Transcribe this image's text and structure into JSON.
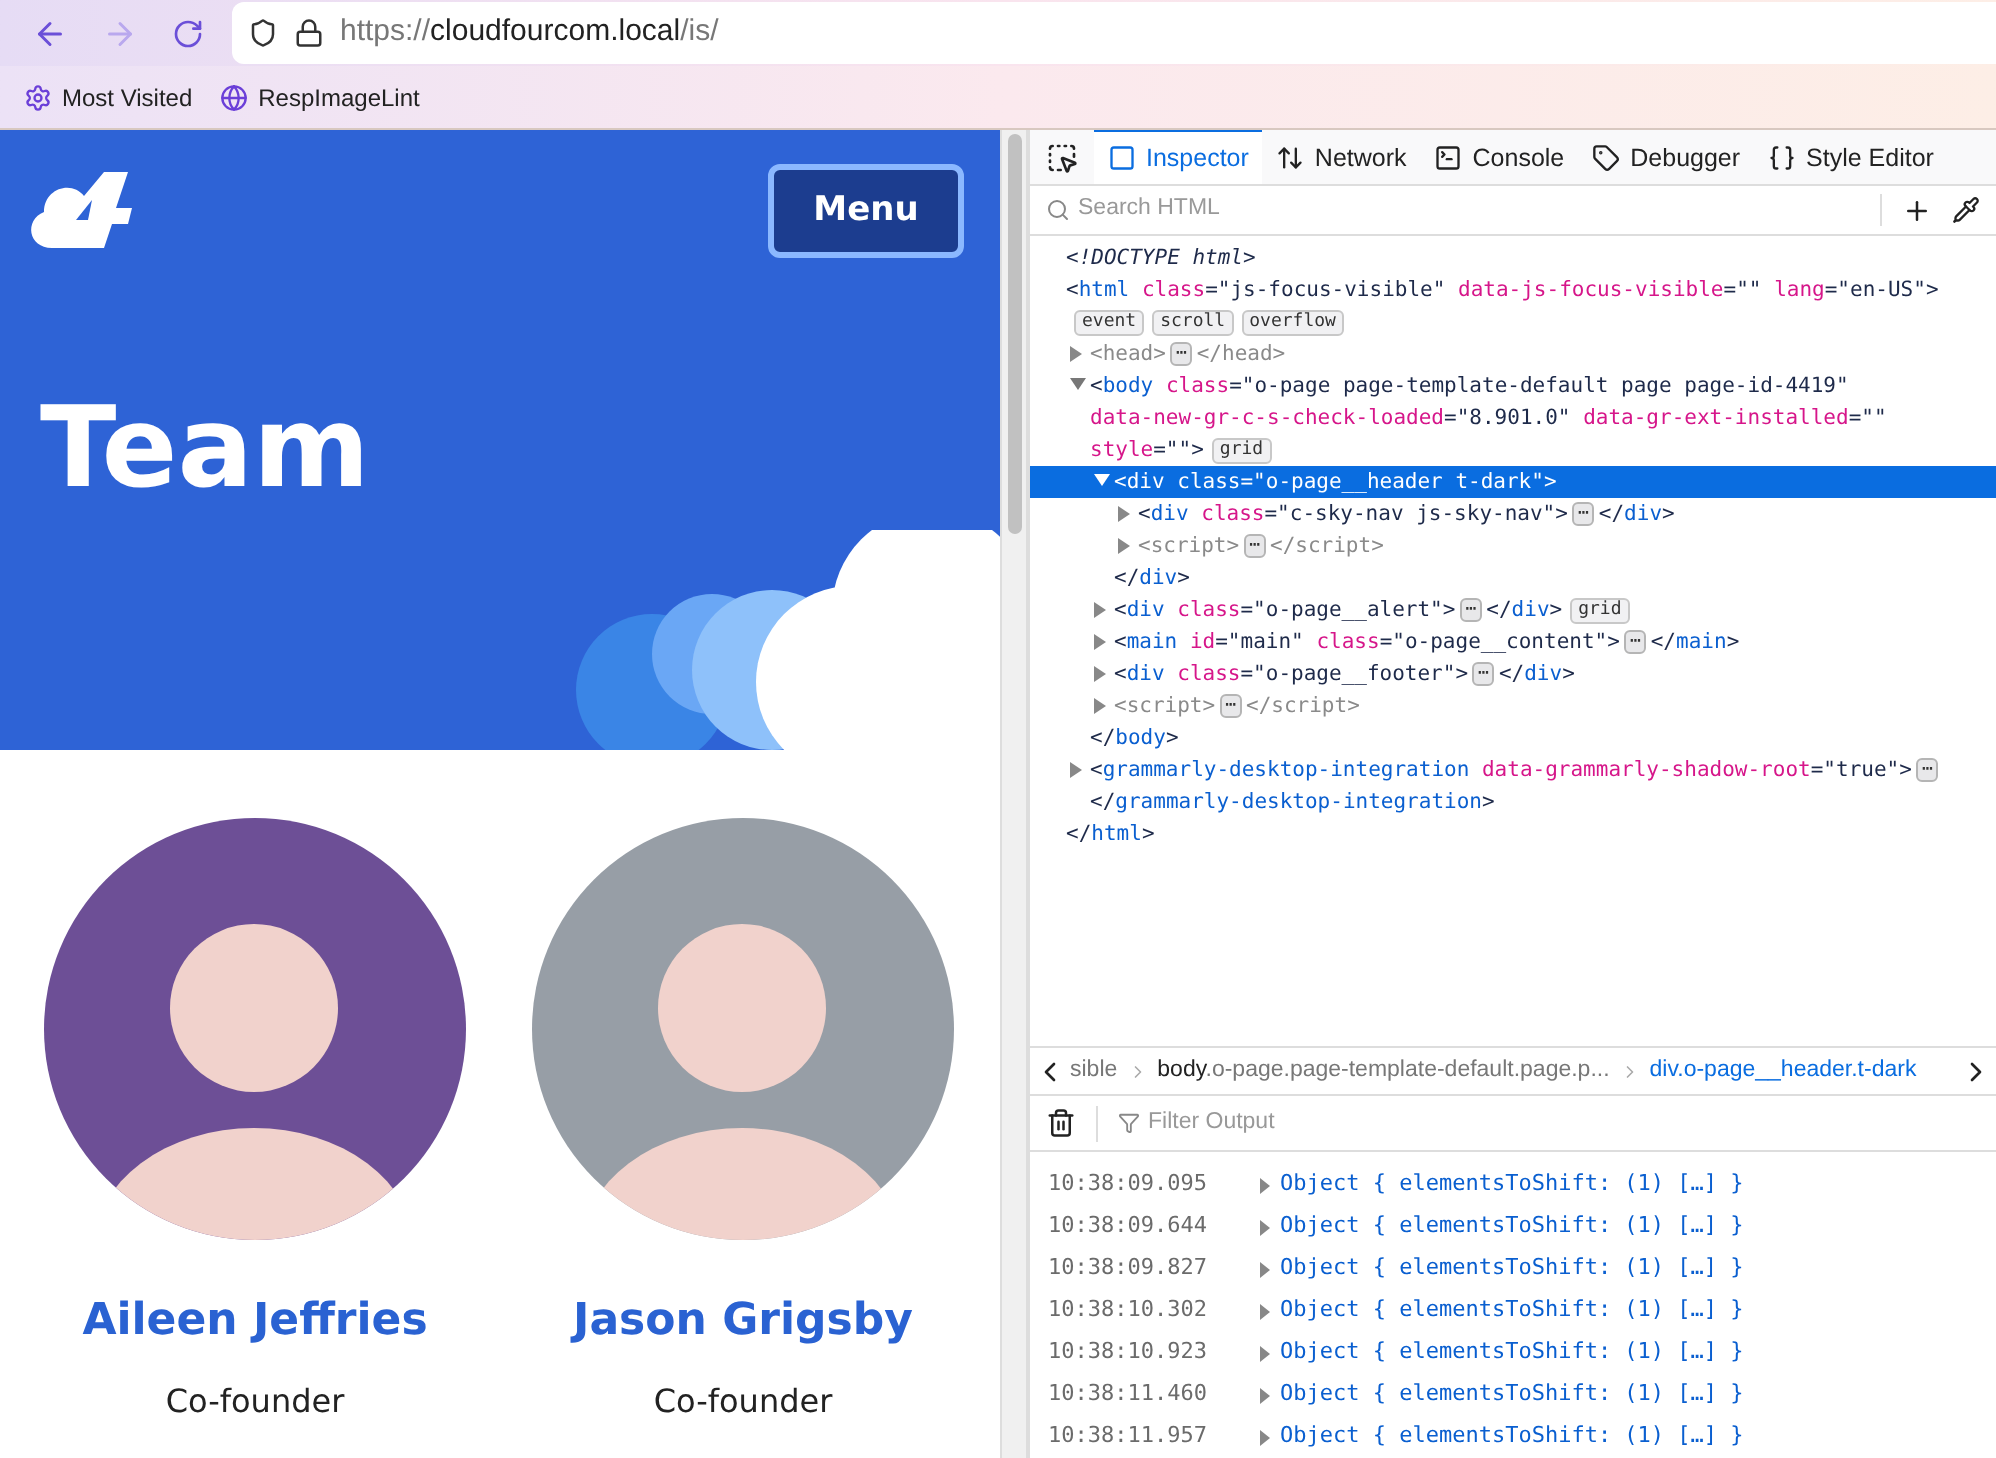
{
  "browser": {
    "url_host": "https://cloudfourcom.local",
    "url_path": "/is/",
    "bookmarks": [
      {
        "kind": "gear",
        "label": "Most Visited"
      },
      {
        "kind": "globe",
        "label": "RespImageLint"
      }
    ]
  },
  "site": {
    "menu_button": "Menu",
    "title": "Team",
    "people": [
      {
        "name": "Aileen Jeffries",
        "role": "Co-founder",
        "color": "#6d4f96"
      },
      {
        "name": "Jason Grigsby",
        "role": "Co-founder",
        "color": "#979ea6"
      }
    ]
  },
  "devtools": {
    "tabs": [
      {
        "label": "Inspector",
        "selected": true
      },
      {
        "label": "Network",
        "selected": false
      },
      {
        "label": "Console",
        "selected": false
      },
      {
        "label": "Debugger",
        "selected": false
      },
      {
        "label": "Style Editor",
        "selected": false
      }
    ],
    "search": {
      "placeholder": "Search HTML"
    },
    "tree": [
      {
        "kind": "plain",
        "tokens": [
          {
            "kind": "doctype",
            "t": "<!DOCTYPE html>"
          }
        ]
      },
      {
        "kind": "root",
        "selected": false,
        "tokens": [
          {
            "kind": "p",
            "t": "<"
          },
          {
            "kind": "tag",
            "t": "html"
          },
          {
            "kind": "attr",
            "t": "class"
          },
          {
            "kind": "val",
            "t": "=\"js-focus-visible\""
          },
          {
            "kind": "attr",
            "t": "data-js-focus-visible"
          },
          {
            "kind": "val",
            "t": "=\"\""
          },
          {
            "kind": "attr",
            "t": "lang"
          },
          {
            "kind": "val",
            "t": "=\"en-US\""
          },
          {
            "kind": "p",
            "t": ">"
          },
          {
            "kind": "badge",
            "t": "event"
          },
          {
            "kind": "badge",
            "t": "scroll"
          },
          {
            "kind": "badge",
            "t": "overflow"
          }
        ],
        "closing": [
          {
            "kind": "p",
            "t": "</"
          },
          {
            "kind": "tag",
            "t": "html"
          },
          {
            "kind": "p",
            "t": ">"
          }
        ],
        "children": [
          {
            "kind": "element",
            "expanded": false,
            "selected": false,
            "tokens": [
              {
                "kind": "muted",
                "t": "<head>"
              },
              {
                "kind": "more",
                "t": "⋯"
              },
              {
                "kind": "muted",
                "t": "</head>"
              }
            ]
          },
          {
            "kind": "element",
            "expanded": true,
            "selected": false,
            "tokens": [
              {
                "kind": "p",
                "t": "<"
              },
              {
                "kind": "tag",
                "t": "body"
              },
              {
                "kind": "attr",
                "t": "class"
              },
              {
                "kind": "val",
                "t": "=\"o-page page-template-default page page-id-4419\""
              },
              {
                "kind": "attr",
                "t": "data-new-gr-c-s-check-loaded"
              },
              {
                "kind": "val",
                "t": "=\"8.901.0\""
              },
              {
                "kind": "attr",
                "t": "data-gr-ext-installed"
              },
              {
                "kind": "val",
                "t": "=\"\""
              },
              {
                "kind": "attr",
                "t": "style"
              },
              {
                "kind": "val",
                "t": "=\"\""
              },
              {
                "kind": "p",
                "t": ">"
              },
              {
                "kind": "badge",
                "t": "grid"
              }
            ],
            "closing": [
              {
                "kind": "p",
                "t": "</"
              },
              {
                "kind": "tag",
                "t": "body"
              },
              {
                "kind": "p",
                "t": ">"
              }
            ],
            "children": [
              {
                "kind": "element",
                "expanded": true,
                "selected": true,
                "tokens": [
                  {
                    "kind": "p",
                    "t": "<"
                  },
                  {
                    "kind": "tag",
                    "t": "div"
                  },
                  {
                    "kind": "attr",
                    "t": "class"
                  },
                  {
                    "kind": "val",
                    "t": "=\"o-page__header t-dark\""
                  },
                  {
                    "kind": "p",
                    "t": ">"
                  }
                ],
                "closing": [
                  {
                    "kind": "p",
                    "t": "</"
                  },
                  {
                    "kind": "tag",
                    "t": "div"
                  },
                  {
                    "kind": "p",
                    "t": ">"
                  }
                ],
                "children": [
                  {
                    "kind": "element",
                    "expanded": false,
                    "selected": false,
                    "tokens": [
                      {
                        "kind": "p",
                        "t": "<"
                      },
                      {
                        "kind": "tag",
                        "t": "div"
                      },
                      {
                        "kind": "attr",
                        "t": "class"
                      },
                      {
                        "kind": "val",
                        "t": "=\"c-sky-nav js-sky-nav\""
                      },
                      {
                        "kind": "p",
                        "t": ">"
                      },
                      {
                        "kind": "more",
                        "t": "⋯"
                      },
                      {
                        "kind": "p",
                        "t": "</"
                      },
                      {
                        "kind": "tag",
                        "t": "div"
                      },
                      {
                        "kind": "p",
                        "t": ">"
                      }
                    ]
                  },
                  {
                    "kind": "element",
                    "expanded": false,
                    "selected": false,
                    "tokens": [
                      {
                        "kind": "muted",
                        "t": "<script>"
                      },
                      {
                        "kind": "more",
                        "t": "⋯"
                      },
                      {
                        "kind": "muted",
                        "t": "</script>"
                      }
                    ]
                  }
                ]
              },
              {
                "kind": "element",
                "expanded": false,
                "selected": false,
                "tokens": [
                  {
                    "kind": "p",
                    "t": "<"
                  },
                  {
                    "kind": "tag",
                    "t": "div"
                  },
                  {
                    "kind": "attr",
                    "t": "class"
                  },
                  {
                    "kind": "val",
                    "t": "=\"o-page__alert\""
                  },
                  {
                    "kind": "p",
                    "t": ">"
                  },
                  {
                    "kind": "more",
                    "t": "⋯"
                  },
                  {
                    "kind": "p",
                    "t": "</"
                  },
                  {
                    "kind": "tag",
                    "t": "div"
                  },
                  {
                    "kind": "p",
                    "t": ">"
                  },
                  {
                    "kind": "badge",
                    "t": "grid"
                  }
                ]
              },
              {
                "kind": "element",
                "expanded": false,
                "selected": false,
                "tokens": [
                  {
                    "kind": "p",
                    "t": "<"
                  },
                  {
                    "kind": "tag",
                    "t": "main"
                  },
                  {
                    "kind": "attr",
                    "t": "id"
                  },
                  {
                    "kind": "val",
                    "t": "=\"main\""
                  },
                  {
                    "kind": "attr",
                    "t": "class"
                  },
                  {
                    "kind": "val",
                    "t": "=\"o-page__content\""
                  },
                  {
                    "kind": "p",
                    "t": ">"
                  },
                  {
                    "kind": "more",
                    "t": "⋯"
                  },
                  {
                    "kind": "p",
                    "t": "</"
                  },
                  {
                    "kind": "tag",
                    "t": "main"
                  },
                  {
                    "kind": "p",
                    "t": ">"
                  }
                ]
              },
              {
                "kind": "element",
                "expanded": false,
                "selected": false,
                "tokens": [
                  {
                    "kind": "p",
                    "t": "<"
                  },
                  {
                    "kind": "tag",
                    "t": "div"
                  },
                  {
                    "kind": "attr",
                    "t": "class"
                  },
                  {
                    "kind": "val",
                    "t": "=\"o-page__footer\""
                  },
                  {
                    "kind": "p",
                    "t": ">"
                  },
                  {
                    "kind": "more",
                    "t": "⋯"
                  },
                  {
                    "kind": "p",
                    "t": "</"
                  },
                  {
                    "kind": "tag",
                    "t": "div"
                  },
                  {
                    "kind": "p",
                    "t": ">"
                  }
                ]
              },
              {
                "kind": "element",
                "expanded": false,
                "selected": false,
                "tokens": [
                  {
                    "kind": "muted",
                    "t": "<script>"
                  },
                  {
                    "kind": "more",
                    "t": "⋯"
                  },
                  {
                    "kind": "muted",
                    "t": "</script>"
                  }
                ]
              }
            ]
          },
          {
            "kind": "element",
            "expanded": false,
            "selected": false,
            "tokens": [
              {
                "kind": "p",
                "t": "<"
              },
              {
                "kind": "tag",
                "t": "grammarly-desktop-integration"
              },
              {
                "kind": "attr",
                "t": "data-grammarly-shadow-root"
              },
              {
                "kind": "val",
                "t": "=\"true\""
              },
              {
                "kind": "p",
                "t": ">"
              },
              {
                "kind": "more",
                "t": "⋯"
              },
              {
                "kind": "p",
                "t": "</"
              },
              {
                "kind": "tag",
                "t": "grammarly-desktop-integration"
              },
              {
                "kind": "p",
                "t": ">"
              }
            ]
          }
        ]
      }
    ],
    "breadcrumbs": [
      {
        "label": "sible",
        "selected": false
      },
      {
        "label": "**body**.o-page.page-template-default.page.p...",
        "selected": false
      },
      {
        "label": "div.o-page__header.t-dark",
        "selected": true
      }
    ],
    "console": {
      "filter_placeholder": "Filter Output",
      "logs": [
        {
          "time": "10:38:09.095",
          "message": "Object { elementsToShift: (1) […] }"
        },
        {
          "time": "10:38:09.644",
          "message": "Object { elementsToShift: (1) […] }"
        },
        {
          "time": "10:38:09.827",
          "message": "Object { elementsToShift: (1) […] }"
        },
        {
          "time": "10:38:10.302",
          "message": "Object { elementsToShift: (1) […] }"
        },
        {
          "time": "10:38:10.923",
          "message": "Object { elementsToShift: (1) […] }"
        },
        {
          "time": "10:38:11.460",
          "message": "Object { elementsToShift: (1) […] }"
        },
        {
          "time": "10:38:11.957",
          "message": "Object { elementsToShift: (1) […] }"
        }
      ]
    }
  }
}
